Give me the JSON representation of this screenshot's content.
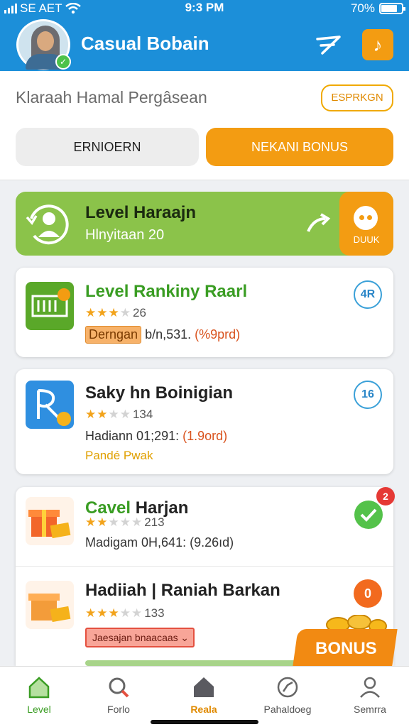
{
  "status_bar": {
    "carrier": "SE AET",
    "time": "9:3 PM",
    "battery": "70%"
  },
  "header": {
    "title": "Casual Bobain",
    "send_icon": "send-icon",
    "music_icon": "music-note-icon"
  },
  "search": {
    "text": "Klaraah Hamal Pergâsean",
    "explore_label": "ESPRKGN"
  },
  "tabs": {
    "left": "ERNIOERN",
    "right": "NEKANI BONUS"
  },
  "level_banner": {
    "title": "Level Haraajn",
    "subtitle": "Hlnyitaan 20",
    "side_label": "DUUK"
  },
  "cards": [
    {
      "name": "Level Rankiny Raarl",
      "rating_count": "26",
      "stars": 3,
      "tag": "Derngan",
      "meta": "b/n,531.",
      "meta_highlight": "(%9prd)",
      "badge": "4R"
    },
    {
      "name": "Saky hn Boinigian",
      "rating_count": "134",
      "stars": 2,
      "meta": "Hadiann 01;291:",
      "meta_highlight": "(1.9ord)",
      "extra": "Pandé Pwak",
      "badge": "16"
    },
    {
      "name_green": "Cavel",
      "name_rest": "Harjan",
      "rating_count": "213",
      "stars": 2,
      "meta": "Madigam 0H,641: (9.26ıd)",
      "notify": "2"
    },
    {
      "name": "Hadiiah | Raniah Barkan",
      "rating_count": "133",
      "stars": 3,
      "dropdown": "Jaesajan bnaacaas",
      "badge": "0",
      "bonus": "BONUS"
    }
  ],
  "bottom_nav": [
    {
      "label": "Level",
      "icon": "home-outline-icon"
    },
    {
      "label": "Forlo",
      "icon": "search-icon"
    },
    {
      "label": "Reala",
      "icon": "home-filled-icon"
    },
    {
      "label": "Pahaldoeg",
      "icon": "compass-icon"
    },
    {
      "label": "Semrra",
      "icon": "person-icon"
    }
  ],
  "colors": {
    "primary": "#1c8fd9",
    "accent": "#f39c12",
    "green": "#8bc34a"
  }
}
